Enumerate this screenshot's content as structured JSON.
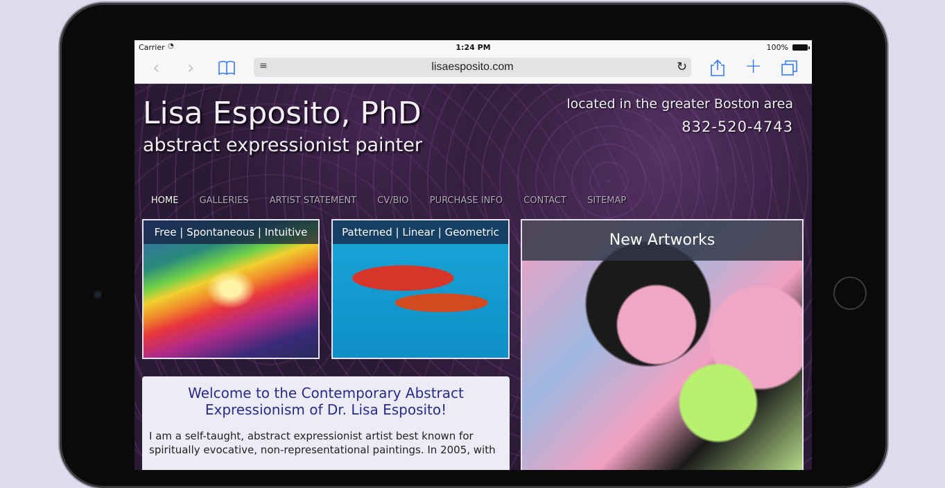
{
  "statusbar": {
    "carrier": "Carrier",
    "time": "1:24 PM",
    "battery": "100%"
  },
  "toolbar": {
    "url": "lisaesposito.com",
    "back_icon": "chevron-left-icon",
    "forward_icon": "chevron-right-icon",
    "bookmarks_icon": "book-icon",
    "reader_icon": "reader-lines-icon",
    "reload_icon": "reload-icon",
    "share_icon": "share-icon",
    "add_icon": "plus-icon",
    "tabs_icon": "tabs-icon",
    "accent": "#3478f6"
  },
  "header": {
    "title": "Lisa Esposito, PhD",
    "subtitle": "abstract expressionist painter",
    "location": "located in the greater Boston area",
    "phone": "832-520-4743"
  },
  "nav": {
    "items": [
      {
        "label": "HOME"
      },
      {
        "label": "GALLERIES"
      },
      {
        "label": "ARTIST STATEMENT"
      },
      {
        "label": "CV/BIO"
      },
      {
        "label": "PURCHASE INFO"
      },
      {
        "label": "CONTACT"
      },
      {
        "label": "SITEMAP"
      }
    ]
  },
  "galleries": [
    {
      "caption": "Free | Spontaneous | Intuitive"
    },
    {
      "caption": "Patterned | Linear | Geometric"
    },
    {
      "caption": "New Artworks"
    }
  ],
  "welcome": {
    "title": "Welcome to the Contemporary Abstract Expressionism of Dr. Lisa Esposito!",
    "body": "I am a self-taught, abstract expressionist artist best known for spiritually evocative, non-representational paintings. In 2005, with"
  }
}
